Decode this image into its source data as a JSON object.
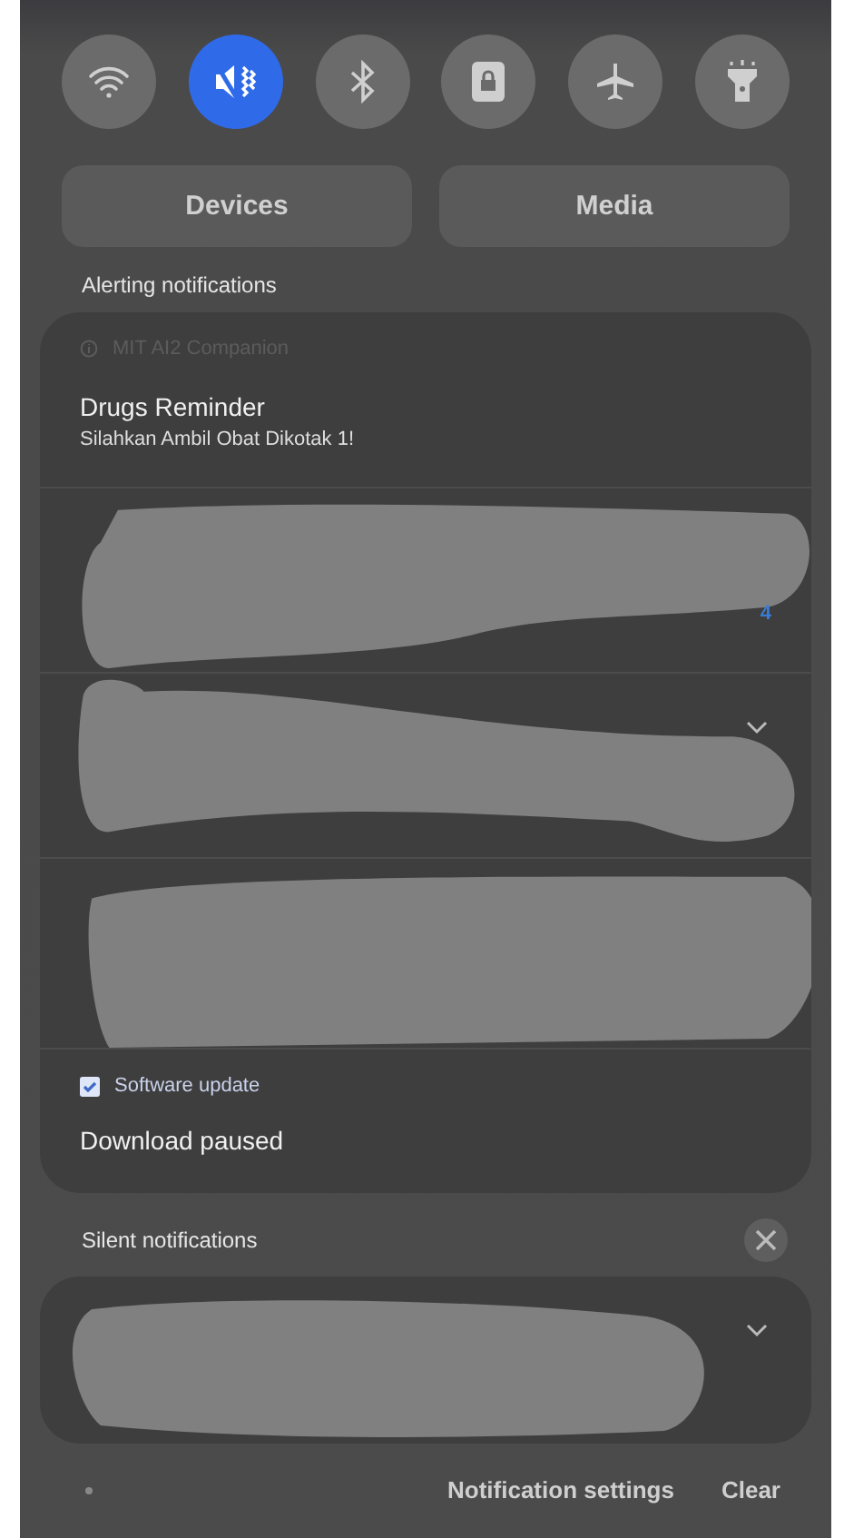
{
  "quick_toggles": [
    {
      "kind": "wifi",
      "on": false
    },
    {
      "kind": "mute",
      "on": true
    },
    {
      "kind": "bluetooth",
      "on": false
    },
    {
      "kind": "lock",
      "on": false
    },
    {
      "kind": "airplane",
      "on": false
    },
    {
      "kind": "flashlight",
      "on": false
    }
  ],
  "panel_buttons": [
    "Devices",
    "Media"
  ],
  "alerting": {
    "title": "Alerting notifications",
    "items": [
      {
        "kind": "text",
        "app": "MIT AI2 Companion",
        "title": "Drugs Reminder",
        "body": "Silahkan Ambil Obat Dikotak 1!"
      },
      {
        "kind": "redacted",
        "count": "4"
      },
      {
        "kind": "redacted",
        "expandable": true
      },
      {
        "kind": "redacted"
      },
      {
        "kind": "checked",
        "app": "Software update",
        "title": "Download paused"
      }
    ]
  },
  "silent": {
    "title": "Silent notifications",
    "items": [
      {
        "kind": "redacted",
        "expandable": true
      }
    ]
  },
  "footer": {
    "settings": "Notification settings",
    "clear": "Clear"
  }
}
